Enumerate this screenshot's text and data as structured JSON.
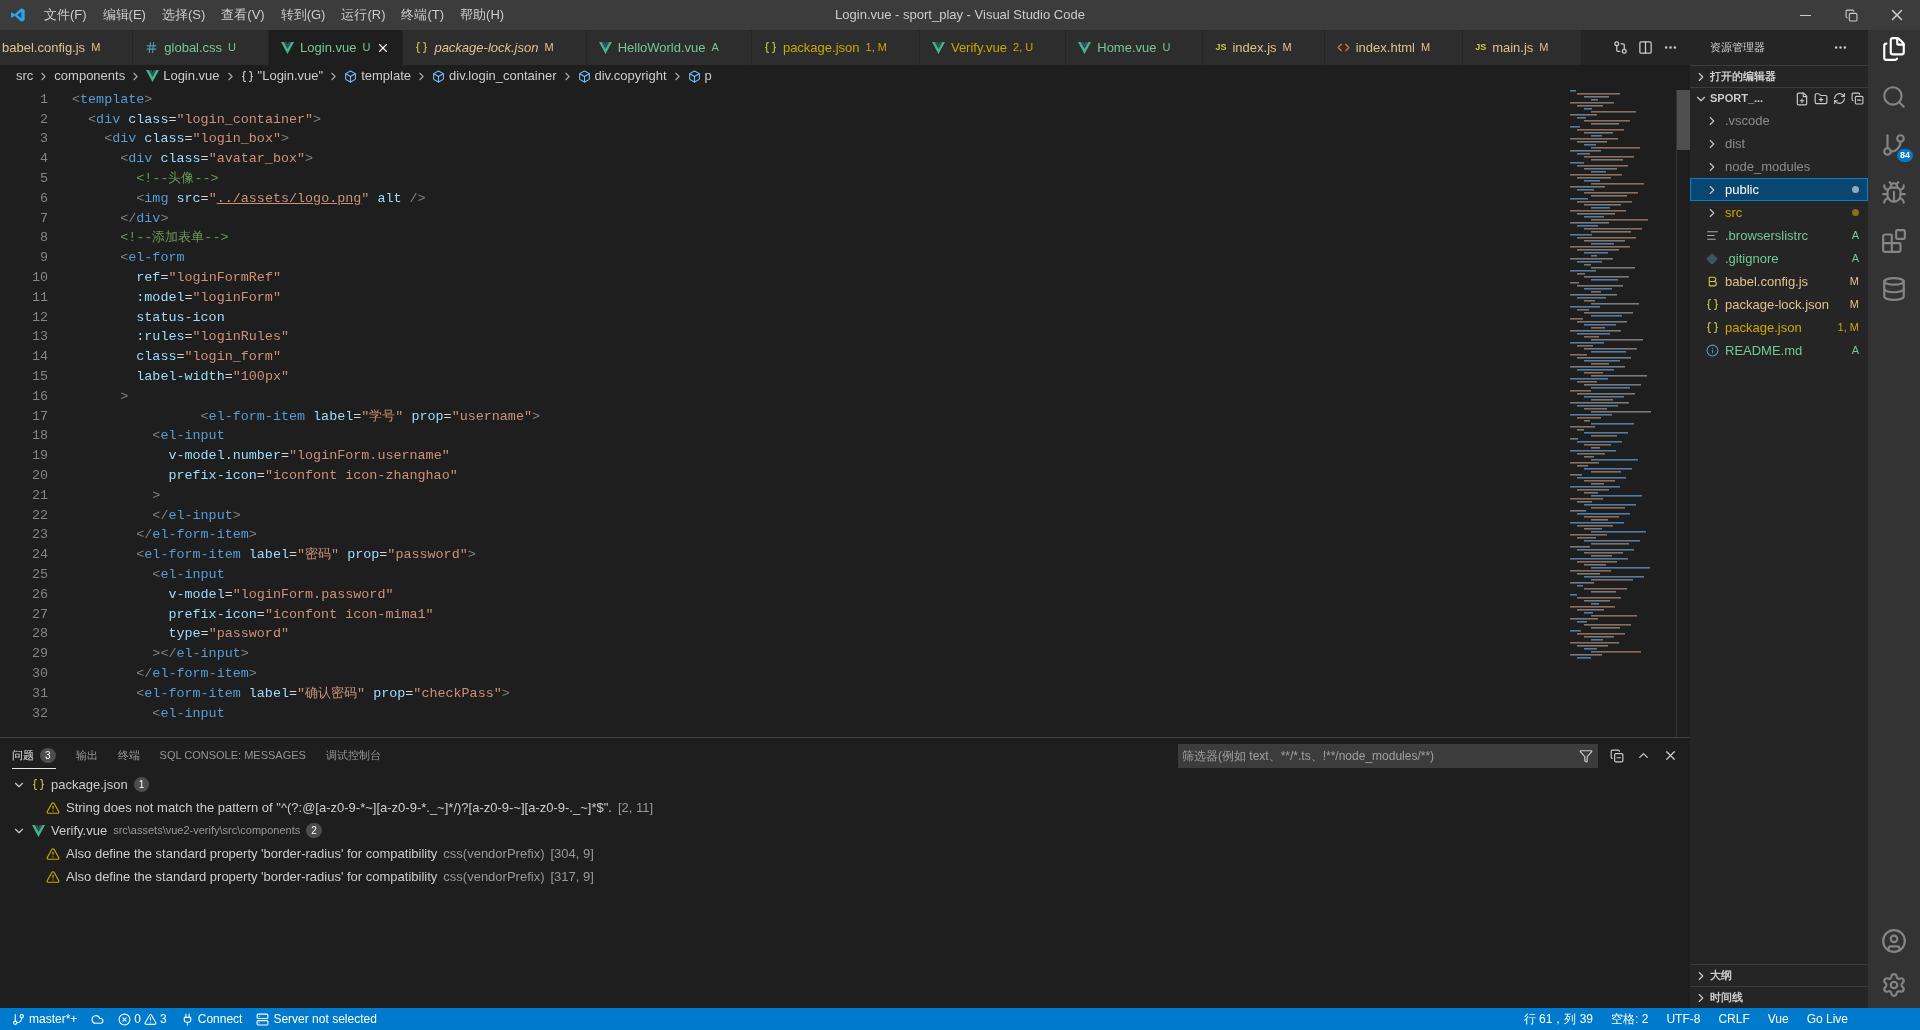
{
  "window": {
    "title": "Login.vue - sport_play - Visual Studio Code"
  },
  "menu": [
    "文件(F)",
    "编辑(E)",
    "选择(S)",
    "查看(V)",
    "转到(G)",
    "运行(R)",
    "终端(T)",
    "帮助(H)"
  ],
  "tabs": [
    {
      "label": "babel.config.js",
      "status": "M",
      "color": "#e2c08d",
      "selected": false,
      "italic": false
    },
    {
      "kind": "css",
      "label": "global.css",
      "status": "U",
      "color": "#73c991",
      "selected": false,
      "italic": false
    },
    {
      "kind": "vue",
      "label": "Login.vue",
      "status": "U",
      "color": "#73c991",
      "selected": true,
      "italic": false
    },
    {
      "kind": "json",
      "label": "package-lock.json",
      "status": "M",
      "color": "#e2c08d",
      "selected": false,
      "italic": true
    },
    {
      "kind": "vue",
      "label": "HelloWorld.vue",
      "status": "A",
      "color": "#73c991",
      "selected": false,
      "italic": false
    },
    {
      "kind": "json",
      "label": "package.json",
      "status": "1, M",
      "color": "#cca700",
      "selected": false,
      "italic": false
    },
    {
      "kind": "vue",
      "label": "Verify.vue",
      "status": "2, U",
      "color": "#cca700",
      "selected": false,
      "italic": false
    },
    {
      "kind": "vue",
      "label": "Home.vue",
      "status": "U",
      "color": "#73c991",
      "selected": false,
      "italic": false
    },
    {
      "kind": "js",
      "icon_label": "JS",
      "label": "index.js",
      "status": "M",
      "color": "#e2c08d",
      "selected": false,
      "italic": false
    },
    {
      "kind": "html",
      "label": "index.html",
      "status": "M",
      "color": "#e2c08d",
      "selected": false,
      "italic": false
    },
    {
      "kind": "js",
      "icon_label": "JS",
      "label": "main.js",
      "status": "M",
      "color": "#e2c08d",
      "selected": false,
      "italic": false
    }
  ],
  "breadcrumb": [
    {
      "kind": "text",
      "label": "src"
    },
    {
      "kind": "text",
      "label": "components"
    },
    {
      "kind": "vue",
      "label": "Login.vue"
    },
    {
      "kind": "braces",
      "label": "\"Login.vue\""
    },
    {
      "kind": "cube",
      "label": "template"
    },
    {
      "kind": "cube",
      "label": "div.login_container"
    },
    {
      "kind": "cube",
      "label": "div.copyright"
    },
    {
      "kind": "cube",
      "label": "p"
    }
  ],
  "code": [
    {
      "number": "1",
      "tokens": [
        {
          "kind": "punct",
          "text": "<"
        },
        {
          "kind": "tag",
          "text": "template"
        },
        {
          "kind": "punct",
          "text": ">"
        }
      ]
    },
    {
      "number": "2",
      "tokens": [
        {
          "kind": "punct",
          "text": "  <"
        },
        {
          "kind": "tag",
          "text": "div"
        },
        {
          "kind": "attr",
          "text": " class"
        },
        {
          "kind": "op",
          "text": "="
        },
        {
          "kind": "string",
          "text": "\"login_container\""
        },
        {
          "kind": "punct",
          "text": ">"
        }
      ]
    },
    {
      "number": "3",
      "tokens": [
        {
          "kind": "punct",
          "text": "    <"
        },
        {
          "kind": "tag",
          "text": "div"
        },
        {
          "kind": "attr",
          "text": " class"
        },
        {
          "kind": "op",
          "text": "="
        },
        {
          "kind": "string",
          "text": "\"login_box\""
        },
        {
          "kind": "punct",
          "text": ">"
        }
      ]
    },
    {
      "number": "4",
      "tokens": [
        {
          "kind": "punct",
          "text": "      <"
        },
        {
          "kind": "tag",
          "text": "div"
        },
        {
          "kind": "attr",
          "text": " class"
        },
        {
          "kind": "op",
          "text": "="
        },
        {
          "kind": "string",
          "text": "\"avatar_box\""
        },
        {
          "kind": "punct",
          "text": ">"
        }
      ]
    },
    {
      "number": "5",
      "tokens": [
        {
          "kind": "comment",
          "text": "        <!--头像-->"
        }
      ]
    },
    {
      "number": "6",
      "tokens": [
        {
          "kind": "punct",
          "text": "        <"
        },
        {
          "kind": "tag",
          "text": "img"
        },
        {
          "kind": "attr",
          "text": " src"
        },
        {
          "kind": "op",
          "text": "="
        },
        {
          "kind": "string",
          "text": "\""
        },
        {
          "kind": "link",
          "text": "../assets/logo.png"
        },
        {
          "kind": "string",
          "text": "\""
        },
        {
          "kind": "attr",
          "text": " alt"
        },
        {
          "kind": "punct",
          "text": " />"
        }
      ]
    },
    {
      "number": "7",
      "tokens": [
        {
          "kind": "punct",
          "text": "      </"
        },
        {
          "kind": "tag",
          "text": "div"
        },
        {
          "kind": "punct",
          "text": ">"
        }
      ]
    },
    {
      "number": "8",
      "tokens": [
        {
          "kind": "comment",
          "text": "      <!--添加表单-->"
        }
      ]
    },
    {
      "number": "9",
      "tokens": [
        {
          "kind": "punct",
          "text": "      <"
        },
        {
          "kind": "tag",
          "text": "el-form"
        }
      ]
    },
    {
      "number": "10",
      "tokens": [
        {
          "kind": "attr",
          "text": "        ref"
        },
        {
          "kind": "op",
          "text": "="
        },
        {
          "kind": "string",
          "text": "\"loginFormRef\""
        }
      ]
    },
    {
      "number": "11",
      "tokens": [
        {
          "kind": "attr",
          "text": "        :model"
        },
        {
          "kind": "op",
          "text": "="
        },
        {
          "kind": "string",
          "text": "\"loginForm\""
        }
      ]
    },
    {
      "number": "12",
      "tokens": [
        {
          "kind": "attr",
          "text": "        status-icon"
        }
      ]
    },
    {
      "number": "13",
      "tokens": [
        {
          "kind": "attr",
          "text": "        :rules"
        },
        {
          "kind": "op",
          "text": "="
        },
        {
          "kind": "string",
          "text": "\"loginRules\""
        }
      ]
    },
    {
      "number": "14",
      "tokens": [
        {
          "kind": "attr",
          "text": "        class"
        },
        {
          "kind": "op",
          "text": "="
        },
        {
          "kind": "string",
          "text": "\"login_form\""
        }
      ]
    },
    {
      "number": "15",
      "tokens": [
        {
          "kind": "attr",
          "text": "        label-width"
        },
        {
          "kind": "op",
          "text": "="
        },
        {
          "kind": "string",
          "text": "\"100px\""
        }
      ]
    },
    {
      "number": "16",
      "tokens": [
        {
          "kind": "punct",
          "text": "      >"
        }
      ]
    },
    {
      "number": "17",
      "tokens": [
        {
          "kind": "punct",
          "text": "                <"
        },
        {
          "kind": "tag",
          "text": "el-form-item"
        },
        {
          "kind": "attr",
          "text": " label"
        },
        {
          "kind": "op",
          "text": "="
        },
        {
          "kind": "string",
          "text": "\"学号\""
        },
        {
          "kind": "attr",
          "text": " prop"
        },
        {
          "kind": "op",
          "text": "="
        },
        {
          "kind": "string",
          "text": "\"username\""
        },
        {
          "kind": "punct",
          "text": ">"
        }
      ]
    },
    {
      "number": "18",
      "tokens": [
        {
          "kind": "punct",
          "text": "          <"
        },
        {
          "kind": "tag",
          "text": "el-input"
        }
      ]
    },
    {
      "number": "19",
      "tokens": [
        {
          "kind": "attr",
          "text": "            v-model.number"
        },
        {
          "kind": "op",
          "text": "="
        },
        {
          "kind": "string",
          "text": "\"loginForm.username\""
        }
      ]
    },
    {
      "number": "20",
      "tokens": [
        {
          "kind": "attr",
          "text": "            prefix-icon"
        },
        {
          "kind": "op",
          "text": "="
        },
        {
          "kind": "string",
          "text": "\"iconfont icon-zhanghao\""
        }
      ]
    },
    {
      "number": "21",
      "tokens": [
        {
          "kind": "punct",
          "text": "          >"
        }
      ]
    },
    {
      "number": "22",
      "tokens": [
        {
          "kind": "punct",
          "text": "          </"
        },
        {
          "kind": "tag",
          "text": "el-input"
        },
        {
          "kind": "punct",
          "text": ">"
        }
      ]
    },
    {
      "number": "23",
      "tokens": [
        {
          "kind": "punct",
          "text": "        </"
        },
        {
          "kind": "tag",
          "text": "el-form-item"
        },
        {
          "kind": "punct",
          "text": ">"
        }
      ]
    },
    {
      "number": "24",
      "tokens": [
        {
          "kind": "punct",
          "text": "        <"
        },
        {
          "kind": "tag",
          "text": "el-form-item"
        },
        {
          "kind": "attr",
          "text": " label"
        },
        {
          "kind": "op",
          "text": "="
        },
        {
          "kind": "string",
          "text": "\"密码\""
        },
        {
          "kind": "attr",
          "text": " prop"
        },
        {
          "kind": "op",
          "text": "="
        },
        {
          "kind": "string",
          "text": "\"password\""
        },
        {
          "kind": "punct",
          "text": ">"
        }
      ]
    },
    {
      "number": "25",
      "tokens": [
        {
          "kind": "punct",
          "text": "          <"
        },
        {
          "kind": "tag",
          "text": "el-input"
        }
      ]
    },
    {
      "number": "26",
      "tokens": [
        {
          "kind": "attr",
          "text": "            v-model"
        },
        {
          "kind": "op",
          "text": "="
        },
        {
          "kind": "string",
          "text": "\"loginForm.password\""
        }
      ]
    },
    {
      "number": "27",
      "tokens": [
        {
          "kind": "attr",
          "text": "            prefix-icon"
        },
        {
          "kind": "op",
          "text": "="
        },
        {
          "kind": "string",
          "text": "\"iconfont icon-mima1\""
        }
      ]
    },
    {
      "number": "28",
      "tokens": [
        {
          "kind": "attr",
          "text": "            type"
        },
        {
          "kind": "op",
          "text": "="
        },
        {
          "kind": "string",
          "text": "\"password\""
        }
      ]
    },
    {
      "number": "29",
      "tokens": [
        {
          "kind": "punct",
          "text": "          ></"
        },
        {
          "kind": "tag",
          "text": "el-input"
        },
        {
          "kind": "punct",
          "text": ">"
        }
      ]
    },
    {
      "number": "30",
      "tokens": [
        {
          "kind": "punct",
          "text": "        </"
        },
        {
          "kind": "tag",
          "text": "el-form-item"
        },
        {
          "kind": "punct",
          "text": ">"
        }
      ]
    },
    {
      "number": "31",
      "tokens": [
        {
          "kind": "punct",
          "text": "        <"
        },
        {
          "kind": "tag",
          "text": "el-form-item"
        },
        {
          "kind": "attr",
          "text": " label"
        },
        {
          "kind": "op",
          "text": "="
        },
        {
          "kind": "string",
          "text": "\"确认密码\""
        },
        {
          "kind": "attr",
          "text": " prop"
        },
        {
          "kind": "op",
          "text": "="
        },
        {
          "kind": "string",
          "text": "\"checkPass\""
        },
        {
          "kind": "punct",
          "text": ">"
        }
      ]
    },
    {
      "number": "32",
      "tokens": [
        {
          "kind": "punct",
          "text": "          <"
        },
        {
          "kind": "tag",
          "text": "el-input"
        }
      ]
    }
  ],
  "panel": {
    "tabs": [
      {
        "label": "问题",
        "count": "3",
        "selected": true
      },
      {
        "label": "输出",
        "selected": false
      },
      {
        "label": "终端",
        "selected": false
      },
      {
        "label": "SQL CONSOLE: MESSAGES",
        "selected": false
      },
      {
        "label": "调试控制台",
        "selected": false
      }
    ],
    "filter": {
      "placeholder": "筛选器(例如 text、**/*.ts、!**/node_modules/**)"
    },
    "problems": [
      {
        "kind": "json",
        "file": "package.json",
        "count": "1",
        "expanded": true,
        "items": [
          {
            "message": "String does not match the pattern of \"^(?:@[a-z0-9-*~][a-z0-9-*._~]*/)?[a-z0-9-~][a-z0-9-._~]*$\".",
            "position": "[2, 11]"
          }
        ]
      },
      {
        "kind": "vue",
        "file": "Verify.vue",
        "path": "src\\assets\\vue2-verify\\src\\components",
        "count": "2",
        "expanded": true,
        "items": [
          {
            "message": "Also define the standard property 'border-radius' for compatibility",
            "source": "css(vendorPrefix)",
            "position": "[304, 9]"
          },
          {
            "message": "Also define the standard property 'border-radius' for compatibility",
            "source": "css(vendorPrefix)",
            "position": "[317, 9]"
          }
        ]
      }
    ]
  },
  "explorer": {
    "title": "资源管理器",
    "sections": [
      {
        "label": "打开的编辑器",
        "expanded": false
      },
      {
        "label": "SPORT_...",
        "expanded": true
      }
    ],
    "items": [
      {
        "kind": "folder",
        "label": ".vscode",
        "color": "#8c8c8c",
        "selected": false
      },
      {
        "kind": "folder",
        "label": "dist",
        "color": "#8c8c8c",
        "selected": false
      },
      {
        "kind": "folder",
        "label": "node_modules",
        "color": "#8c8c8c",
        "selected": false
      },
      {
        "kind": "folder",
        "label": "public",
        "dot": {
          "color": "#8fa8c8"
        },
        "selected": true
      },
      {
        "kind": "folder",
        "label": "src",
        "color": "#cca700",
        "dot": {
          "color": "#8a6d1e"
        },
        "selected": false
      },
      {
        "kind": "lines",
        "label": ".browserslistrc",
        "color": "#73c991",
        "badge": "A",
        "selected": false
      },
      {
        "kind": "diamond",
        "label": ".gitignore",
        "color": "#73c991",
        "badge": "A",
        "selected": false
      },
      {
        "kind": "babel",
        "label": "babel.config.js",
        "color": "#e2c08d",
        "badge": "M",
        "selected": false
      },
      {
        "kind": "json",
        "label": "package-lock.json",
        "color": "#e2c08d",
        "badge": "M",
        "selected": false
      },
      {
        "kind": "json",
        "label": "package.json",
        "color": "#cca700",
        "badge": "1, M",
        "selected": false
      },
      {
        "kind": "info",
        "label": "README.md",
        "color": "#73c991",
        "badge": "A",
        "selected": false
      }
    ],
    "bottom_sections": [
      "大纲",
      "时间线"
    ]
  },
  "activity_bar": {
    "scm_badge": "84"
  },
  "status_bar": {
    "branch": "master*+",
    "errors": "0",
    "warnings": "3",
    "connect": "Connect",
    "server": "Server not selected",
    "right": [
      "行 61，列 39",
      "空格: 2",
      "UTF-8",
      "CRLF",
      "Vue",
      "Go Live"
    ]
  }
}
